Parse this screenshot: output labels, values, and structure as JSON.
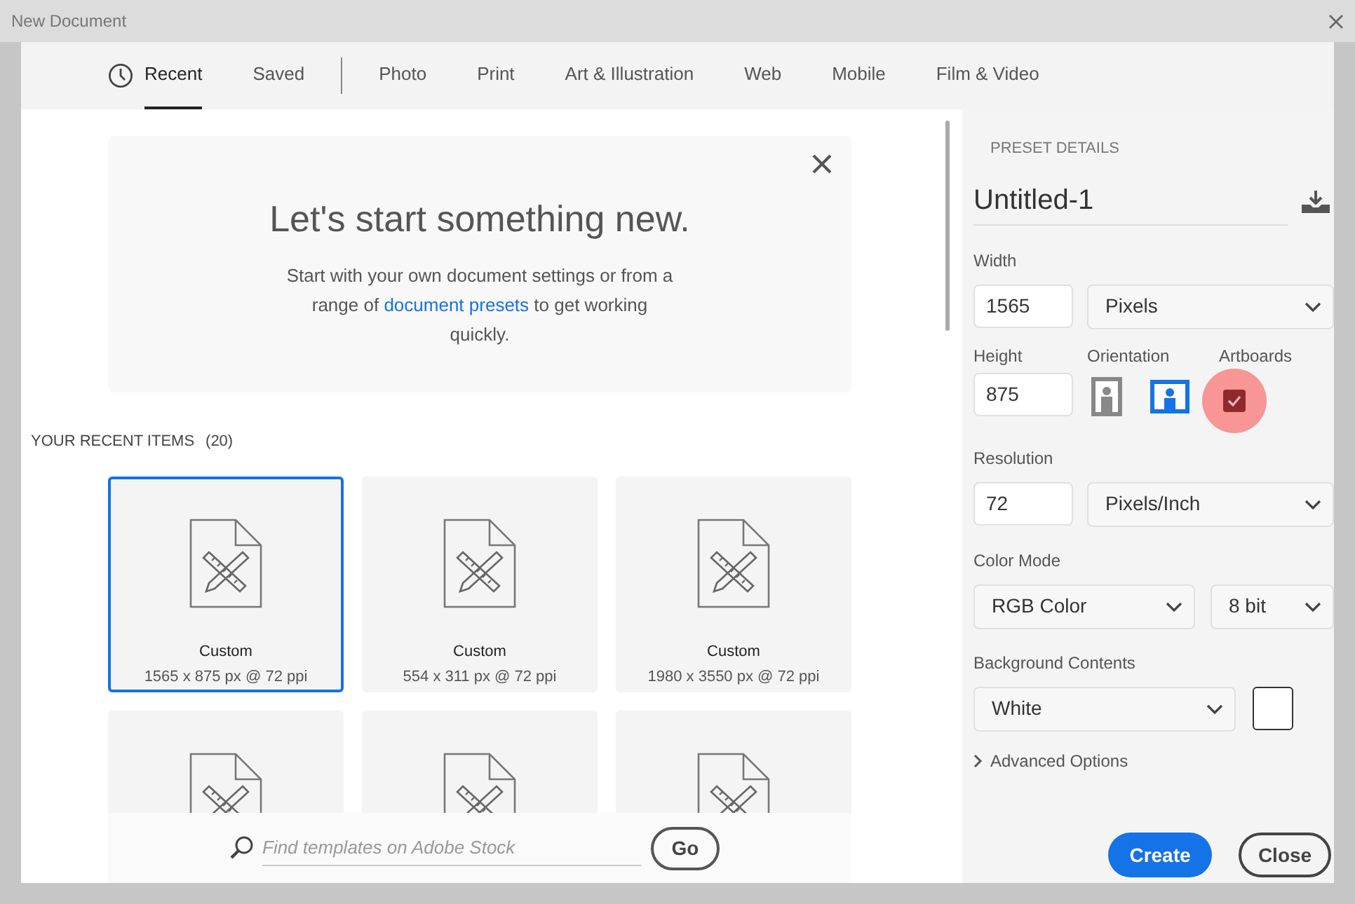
{
  "window": {
    "title": "New Document"
  },
  "tabs": [
    {
      "kind": "clock-tab",
      "label": "Recent",
      "selected": true
    },
    {
      "kind": "tab",
      "label": "Saved",
      "selected": false
    },
    {
      "kind": "divider"
    },
    {
      "kind": "tab",
      "label": "Photo",
      "selected": false
    },
    {
      "kind": "tab",
      "label": "Print",
      "selected": false
    },
    {
      "kind": "tab",
      "label": "Art & Illustration",
      "selected": false
    },
    {
      "kind": "tab",
      "label": "Web",
      "selected": false
    },
    {
      "kind": "tab",
      "label": "Mobile",
      "selected": false
    },
    {
      "kind": "tab",
      "label": "Film & Video",
      "selected": false
    }
  ],
  "welcome": {
    "title": "Let's start something new.",
    "text_before": "Start with your own document settings or from a range of",
    "link": "document presets",
    "text_after": "to get working quickly."
  },
  "recent": {
    "heading": "YOUR RECENT ITEMS",
    "count": "(20)",
    "items": [
      {
        "kind": "full",
        "name": "Custom",
        "size": "1565 x 875 px @ 72 ppi",
        "selected": true
      },
      {
        "kind": "full",
        "name": "Custom",
        "size": "554 x 311 px @ 72 ppi",
        "selected": false
      },
      {
        "kind": "full",
        "name": "Custom",
        "size": "1980 x 3550 px @ 72 ppi",
        "selected": false
      },
      {
        "kind": "cut-off",
        "selected": false
      },
      {
        "kind": "cut-off",
        "selected": false
      },
      {
        "kind": "cut-off",
        "selected": false
      }
    ]
  },
  "search": {
    "placeholder": "Find templates on Adobe Stock",
    "button": "Go"
  },
  "preset": {
    "heading": "PRESET DETAILS",
    "name": "Untitled-1",
    "width": {
      "label": "Width",
      "value": "1565",
      "unit": "Pixels"
    },
    "height": {
      "label": "Height",
      "value": "875"
    },
    "orientation": {
      "label": "Orientation",
      "options": [
        {
          "kind": "portrait",
          "selected": false
        },
        {
          "kind": "landscape",
          "selected": true
        }
      ]
    },
    "artboards": {
      "label": "Artboards",
      "checked": true
    },
    "resolution": {
      "label": "Resolution",
      "value": "72",
      "unit": "Pixels/Inch"
    },
    "color_mode": {
      "label": "Color Mode",
      "mode": "RGB Color",
      "depth": "8 bit"
    },
    "background": {
      "label": "Background Contents",
      "value": "White",
      "color": "#ffffff"
    },
    "advanced": {
      "label": "Advanced Options",
      "expanded": false
    }
  },
  "buttons": {
    "create": "Create",
    "close": "Close"
  }
}
